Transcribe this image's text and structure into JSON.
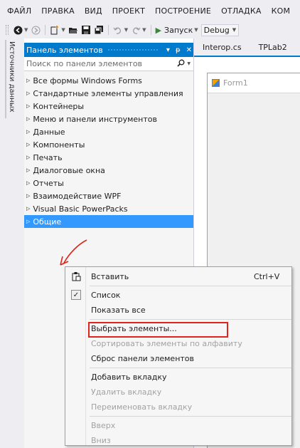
{
  "menubar": {
    "items": [
      "ФАЙЛ",
      "ПРАВКА",
      "ВИД",
      "ПРОЕКТ",
      "ПОСТРОЕНИЕ",
      "ОТЛАДКА",
      "КОМ"
    ]
  },
  "toolbar": {
    "run_label": "Запуск",
    "config": "Debug"
  },
  "side_tab": {
    "label": "Источники данных"
  },
  "toolbox": {
    "title": "Панель элементов",
    "title_controls": [
      "▾",
      "ᵽ",
      "✕"
    ],
    "search_placeholder": "Поиск по панели элементов",
    "categories": [
      "Все формы Windows Forms",
      "Стандартные элементы управления",
      "Контейнеры",
      "Меню и панели инструментов",
      "Данные",
      "Компоненты",
      "Печать",
      "Диалоговые окна",
      "Отчеты",
      "Взаимодействие WPF",
      "Visual Basic PowerPacks",
      "Общие"
    ],
    "selected_index": 11
  },
  "editor": {
    "tabs": [
      "Interop.cs",
      "TPLab2"
    ],
    "form_title": "Form1"
  },
  "context_menu": {
    "paste": {
      "label": "Вставить",
      "shortcut": "Ctrl+V"
    },
    "list": {
      "label": "Список",
      "checked": true
    },
    "show_all": {
      "label": "Показать все"
    },
    "choose_items": {
      "label": "Выбрать элементы..."
    },
    "sort_alpha": {
      "label": "Сортировать элементы по алфавиту",
      "disabled": true
    },
    "reset_toolbox": {
      "label": "Сброс панели элементов"
    },
    "add_tab": {
      "label": "Добавить вкладку"
    },
    "delete_tab": {
      "label": "Удалить вкладку",
      "disabled": true
    },
    "rename_tab": {
      "label": "Переименовать вкладку",
      "disabled": true
    },
    "move_up": {
      "label": "Вверх",
      "disabled": true
    },
    "move_down": {
      "label": "Вниз",
      "disabled": true
    }
  },
  "colors": {
    "accent": "#007acc",
    "selection": "#3399ff",
    "highlight_box": "#e0241b",
    "annotation_arrow": "#e0241b"
  },
  "icons": {
    "back": "back-arrow-icon",
    "forward": "forward-arrow-icon",
    "new_project": "new-project-icon",
    "open": "open-file-icon",
    "save": "save-icon",
    "save_all": "save-all-icon",
    "undo": "undo-icon",
    "redo": "redo-icon",
    "run": "play-icon",
    "search": "search-icon",
    "paste": "paste-icon",
    "form": "form-icon"
  }
}
